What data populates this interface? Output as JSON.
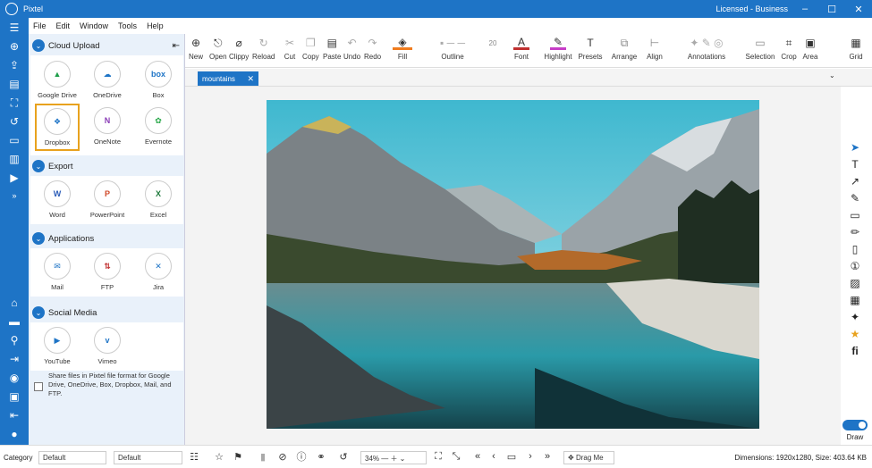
{
  "title_bar": {
    "app_name": "Pixtel",
    "license": "Licensed - Business",
    "minimize": "–",
    "maximize": "☐",
    "close": "✕"
  },
  "menu": {
    "file": "File",
    "edit": "Edit",
    "window": "Window",
    "tools": "Tools",
    "help": "Help"
  },
  "toolbar": {
    "new": "New",
    "open": "Open",
    "clippy": "Clippy",
    "reload": "Reload",
    "cut": "Cut",
    "copy": "Copy",
    "paste": "Paste",
    "undo": "Undo",
    "redo": "Redo",
    "fill": "Fill",
    "outline": "Outline",
    "font_size": "20",
    "font": "Font",
    "highlight": "Highlight",
    "presets": "Presets",
    "arrange": "Arrange",
    "align": "Align",
    "annotations": "Annotations",
    "selection": "Selection",
    "crop": "Crop",
    "area": "Area",
    "grid": "Grid"
  },
  "sidebar": {
    "cloud_upload": {
      "title": "Cloud Upload",
      "items": [
        "Google Drive",
        "OneDrive",
        "Box",
        "Dropbox",
        "OneNote",
        "Evernote"
      ]
    },
    "export": {
      "title": "Export",
      "items": [
        "Word",
        "PowerPoint",
        "Excel"
      ]
    },
    "applications": {
      "title": "Applications",
      "items": [
        "Mail",
        "FTP",
        "Jira"
      ]
    },
    "social_media": {
      "title": "Social Media",
      "items": [
        "YouTube",
        "Vimeo"
      ]
    },
    "share_note": "Share files in Pixtel file format for Google Drive, OneDrive, Box, Dropbox, Mail, and FTP."
  },
  "document": {
    "tab_name": "mountains"
  },
  "right_panel": {
    "draw_label": "Draw"
  },
  "status_bar": {
    "category_label": "Category",
    "category_value": "Default",
    "style_value": "Default",
    "zoom": "34%",
    "drag_me": "Drag Me",
    "dimensions": "Dimensions: 1920x1280, Size: 403.64 KB"
  },
  "colors": {
    "accent": "#1e74c6",
    "selected_border": "#e8a21e",
    "sidebar_bg": "#e9f1fa"
  }
}
